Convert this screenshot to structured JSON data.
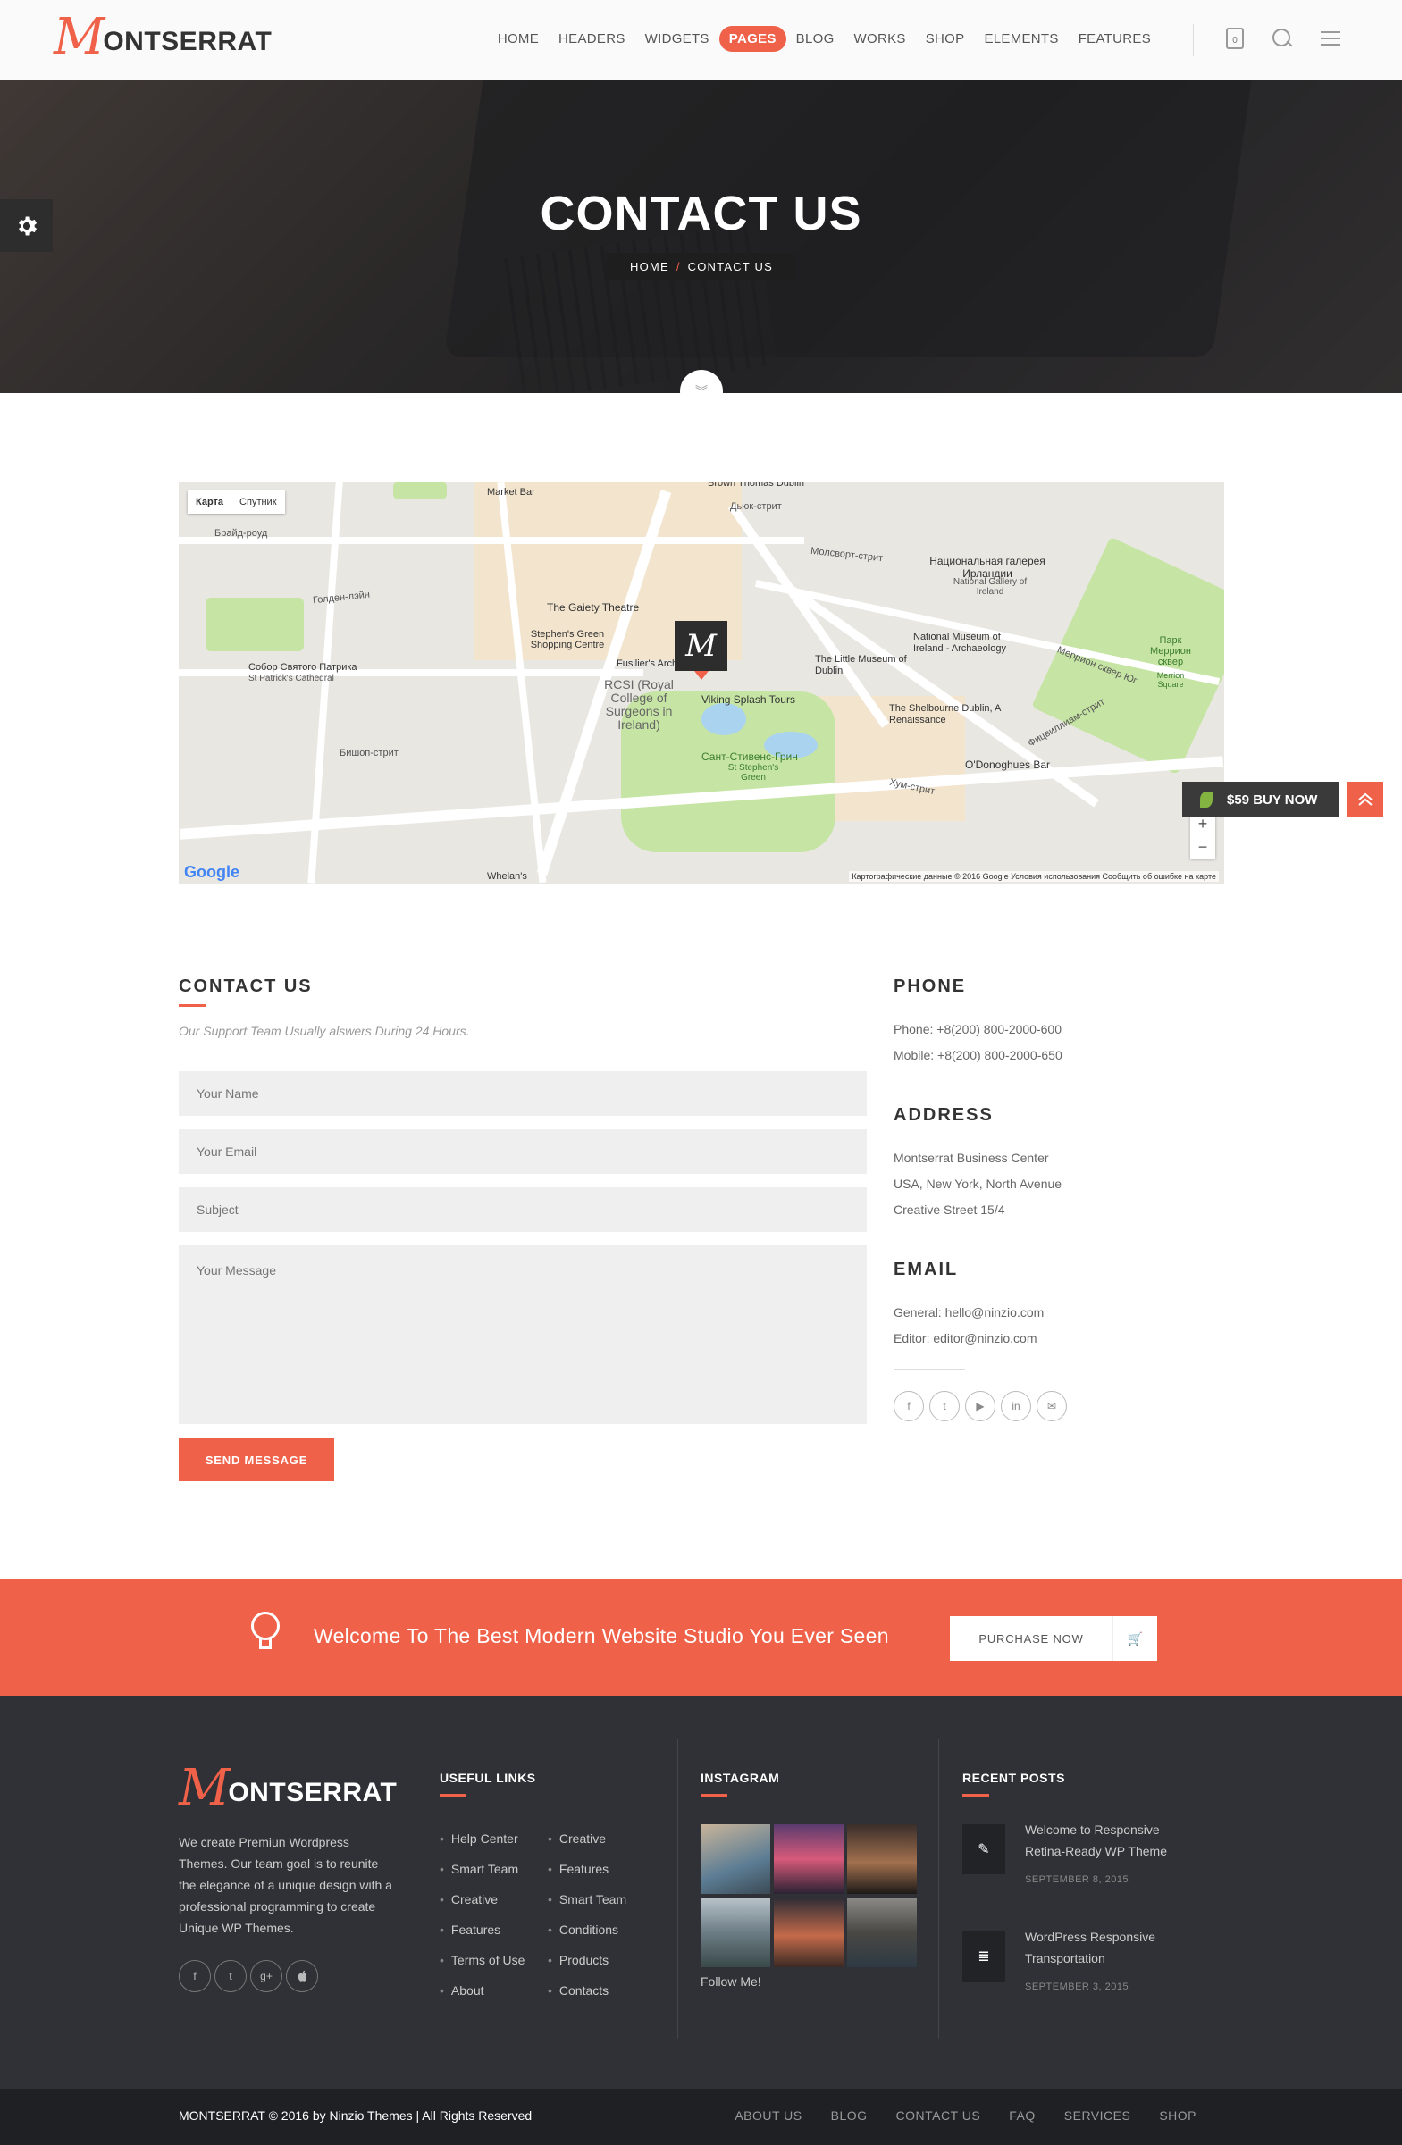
{
  "header": {
    "logo_m": "M",
    "logo_text": "ONTSERRAT",
    "nav": [
      "HOME",
      "HEADERS",
      "WIDGETS",
      "PAGES",
      "BLOG",
      "WORKS",
      "SHOP",
      "ELEMENTS",
      "FEATURES"
    ],
    "active_nav": "PAGES",
    "cart_count": "0"
  },
  "hero": {
    "title": "CONTACT US",
    "crumb_home": "HOME",
    "crumb_sep": "/",
    "crumb_current": "CONTACT US"
  },
  "map": {
    "tab_map": "Карта",
    "tab_satellite": "Спутник",
    "marker_letter": "M",
    "google": "Google",
    "copyright": "Картографические данные © 2016 Google    Условия использования    Сообщить об ошибке на карте",
    "zoom_in": "+",
    "zoom_out": "−",
    "labels": {
      "market_bar": "Market Bar",
      "brown_thomas": "Brown Thomas Dublin",
      "dyuk": "Дьюк-стрит",
      "molsvort": "Молсворт-стрит",
      "gallery": "Национальная галерея Ирландии",
      "gallery_en": "National Gallery of Ireland",
      "braid": "Брайд-роуд",
      "golden": "Голден-лэйн",
      "gaiety": "The Gaiety Theatre",
      "stephens": "Stephen's Green Shopping Centre",
      "museum": "National Museum of Ireland - Archaeology",
      "little_museum": "The Little Museum of Dublin",
      "fusiliers": "Fusilier's Arch",
      "patrick": "Собор Святого Патрика",
      "patrick_en": "St Patrick's Cathedral",
      "rcsi": "RCSI (Royal College of Surgeons in Ireland)",
      "viking": "Viking Splash Tours",
      "shelbourne": "The Shelbourne Dublin, A Renaissance",
      "green_ru": "Сант-Стивенс-Грин",
      "green_en": "St Stephen's Green",
      "donoghues": "O'Donoghues Bar",
      "merrion": "Парк Меррион сквер",
      "merrion_en": "Merrion Square",
      "bishop": "Бишоп-стрит",
      "whelans": "Whelan's",
      "hum": "Хум-стрит",
      "fitz": "Фицвиллиам-стрит",
      "merrion_sq": "Меррион сквер Юг"
    }
  },
  "floating": {
    "buy_label": "$59 BUY NOW"
  },
  "contact": {
    "title": "CONTACT US",
    "subtitle": "Our Support Team Usually alswers During 24 Hours.",
    "name_placeholder": "Your Name",
    "email_placeholder": "Your Email",
    "subject_placeholder": "Subject",
    "message_placeholder": "Your Message",
    "send_label": "SEND MESSAGE"
  },
  "info": {
    "phone_title": "PHONE",
    "phone_line1": "Phone: +8(200) 800-2000-600",
    "phone_line2": "Mobile: +8(200) 800-2000-650",
    "address_title": "ADDRESS",
    "address_line1": "Montserrat Business Center",
    "address_line2": "USA, New York, North Avenue",
    "address_line3": "Creative Street 15/4",
    "email_title": "EMAIL",
    "email_line1": "General: hello@ninzio.com",
    "email_line2": "Editor: editor@ninzio.com",
    "social": [
      "f",
      "t",
      "▶",
      "in",
      "✉"
    ]
  },
  "promo": {
    "text": "Welcome To The Best Modern Website Studio You Ever Seen",
    "button": "PURCHASE NOW"
  },
  "footer": {
    "about": "We create Premiun Wordpress Themes. Our team goal is to reunite the elegance of a unique design with a professional programming to create Unique WP Themes.",
    "social": [
      "f",
      "t",
      "g+",
      ""
    ],
    "links_title": "USEFUL LINKS",
    "links_col1": [
      "Help Center",
      "Smart Team",
      "Creative",
      "Features",
      "Terms of Use",
      "About"
    ],
    "links_col2": [
      "Creative",
      "Features",
      "Smart Team",
      "Conditions",
      "Products",
      "Contacts"
    ],
    "instagram_title": "INSTAGRAM",
    "follow": "Follow Me!",
    "posts_title": "RECENT POSTS",
    "posts": [
      {
        "title": "Welcome to Responsive Retina-Ready WP Theme",
        "date": "SEPTEMBER 8, 2015"
      },
      {
        "title": "WordPress Responsive Transportation",
        "date": "SEPTEMBER 3, 2015"
      }
    ]
  },
  "bottom": {
    "copyright": "MONTSERRAT © 2016 by Ninzio Themes | All Rights Reserved",
    "links": [
      "ABOUT US",
      "BLOG",
      "CONTACT US",
      "FAQ",
      "SERVICES",
      "SHOP"
    ]
  }
}
